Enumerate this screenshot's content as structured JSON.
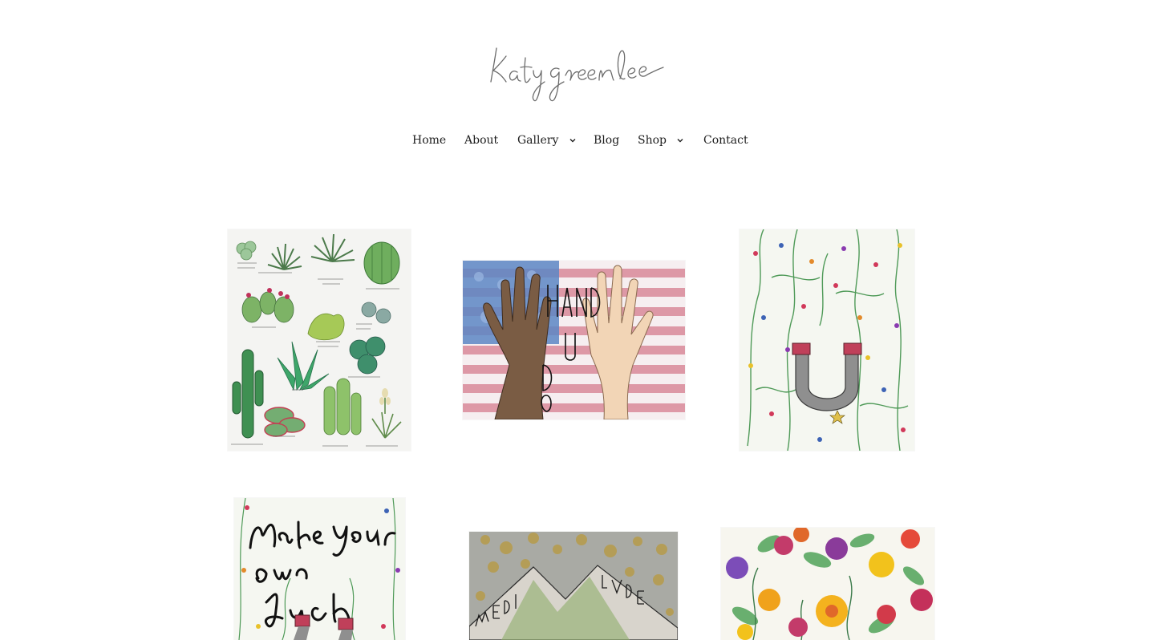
{
  "site": {
    "logo_text": "Katy greenlee"
  },
  "nav": {
    "items": [
      {
        "label": "Home",
        "has_dropdown": false
      },
      {
        "label": "About",
        "has_dropdown": false
      },
      {
        "label": "Gallery",
        "has_dropdown": true
      },
      {
        "label": "Blog",
        "has_dropdown": false
      },
      {
        "label": "Shop",
        "has_dropdown": true
      },
      {
        "label": "Contact",
        "has_dropdown": false
      }
    ]
  },
  "gallery": {
    "items": [
      {
        "subject": "succulent-illustration",
        "labels": [
          "CHINESE SEDUM",
          "HOBBIT'S PAINTBRUSH",
          "SILVER DESERT SPOON",
          "GOLDEN BARREL",
          "BUNNY EARS",
          "GHOST PLANT",
          "ANGELINA STONECROP",
          "SILKEN PINCUSHION",
          "ALOE",
          "SAGUARO CACTI",
          "FLAPJACK",
          "GOLDEN BALL",
          "ADAM'S NEEDLE"
        ]
      },
      {
        "subject": "hands-up-flag",
        "lettering": "HANDS UP, DON'T SHOOT"
      },
      {
        "subject": "floral-horseshoe"
      },
      {
        "subject": "make-your-own-luck",
        "lettering": "Make Your own Luck"
      },
      {
        "subject": "mountains-medicine",
        "lettering": "MEDICINE FOR THE PEOPLE"
      },
      {
        "subject": "watercolor-flowers"
      }
    ]
  },
  "colors": {
    "background": "#ffffff",
    "nav_text": "#1d1d1d",
    "logo_ink": "#6b6b6b"
  }
}
